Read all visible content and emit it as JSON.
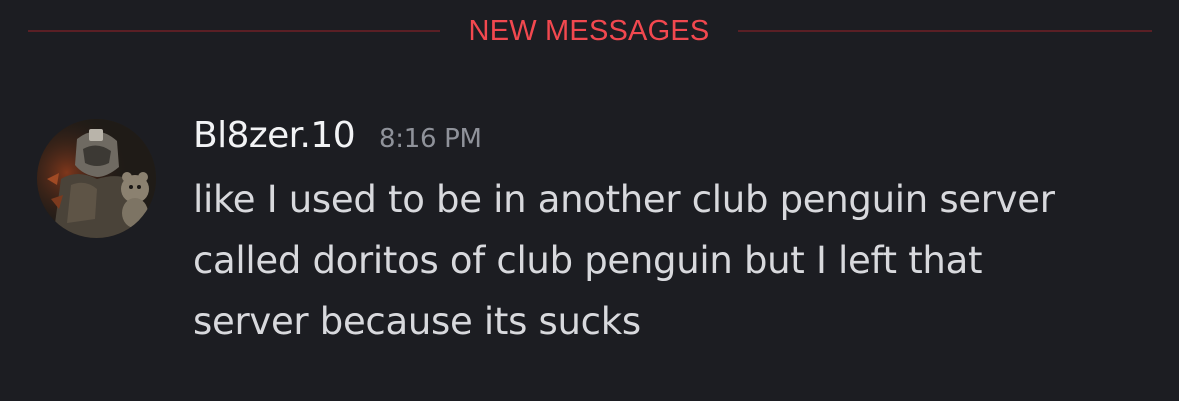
{
  "divider": {
    "label": "NEW MESSAGES",
    "color": "#f2484f"
  },
  "message": {
    "author": "Bl8zer.10",
    "timestamp": "8:16 PM",
    "lines": [
      "like I used to be in another club penguin server",
      "called doritos of club penguin but I left that",
      "server because its sucks"
    ]
  },
  "colors": {
    "background": "#1c1d22",
    "username": "#f2f3f5",
    "timestamp": "#8f929a",
    "body_text": "#d8d9dd"
  }
}
